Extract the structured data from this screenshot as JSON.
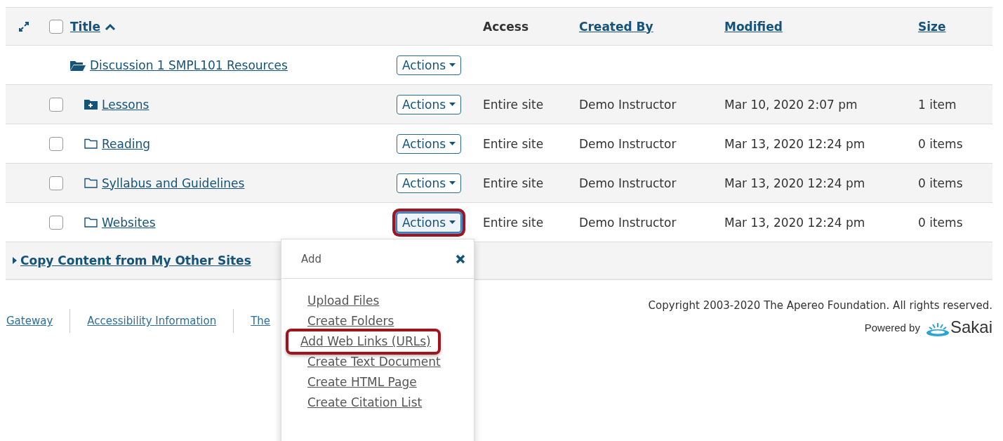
{
  "table": {
    "columns": [
      {
        "label": "Title",
        "kind": "link",
        "sorted": true
      },
      {
        "kind": "blank"
      },
      {
        "label": "Access",
        "kind": "plain",
        "sorted": false
      },
      {
        "label": "Created By",
        "kind": "link",
        "sorted": false
      },
      {
        "label": "Modified",
        "kind": "link",
        "sorted": false
      },
      {
        "label": "Size",
        "kind": "link",
        "sorted": false
      }
    ],
    "select_all_checked": false,
    "rows": [
      {
        "kind": "parent",
        "title": "Discussion 1 SMPL101 Resources",
        "action": "Actions",
        "highlighted": false
      },
      {
        "kind": "added",
        "checked": false,
        "title": "Lessons",
        "action": "Actions",
        "highlighted": false,
        "access": "Entire site",
        "created_by": "Demo Instructor",
        "modified": "Mar 10, 2020 2:07 pm",
        "size": "1 item"
      },
      {
        "kind": "folder",
        "checked": false,
        "title": "Reading",
        "action": "Actions",
        "highlighted": false,
        "access": "Entire site",
        "created_by": "Demo Instructor",
        "modified": "Mar 13, 2020 12:24 pm",
        "size": "0 items"
      },
      {
        "kind": "folder",
        "checked": false,
        "title": "Syllabus and Guidelines",
        "action": "Actions",
        "highlighted": false,
        "access": "Entire site",
        "created_by": "Demo Instructor",
        "modified": "Mar 13, 2020 12:24 pm",
        "size": "0 items"
      },
      {
        "kind": "folder",
        "checked": false,
        "title": "Websites",
        "action": "Actions",
        "highlighted": true,
        "access": "Entire site",
        "created_by": "Demo Instructor",
        "modified": "Mar 13, 2020 12:24 pm",
        "size": "0 items"
      }
    ]
  },
  "copy_link": "Copy Content from My Other Sites",
  "menu": {
    "header": "Add",
    "items": [
      {
        "label": "Upload Files",
        "highlighted": false
      },
      {
        "label": "Create Folders",
        "highlighted": false
      },
      {
        "label": "Add Web Links (URLs)",
        "highlighted": true
      },
      {
        "label": "Create Text Document",
        "highlighted": false
      },
      {
        "label": "Create HTML Page",
        "highlighted": false
      },
      {
        "label": "Create Citation List",
        "highlighted": false
      }
    ]
  },
  "footer": {
    "links": [
      "Gateway",
      "Accessibility Information",
      "The"
    ],
    "copyright": "Copyright 2003-2020 The Apereo Foundation. All rights reserved.",
    "powered_by": "Powered by",
    "brand": "Sakai"
  }
}
